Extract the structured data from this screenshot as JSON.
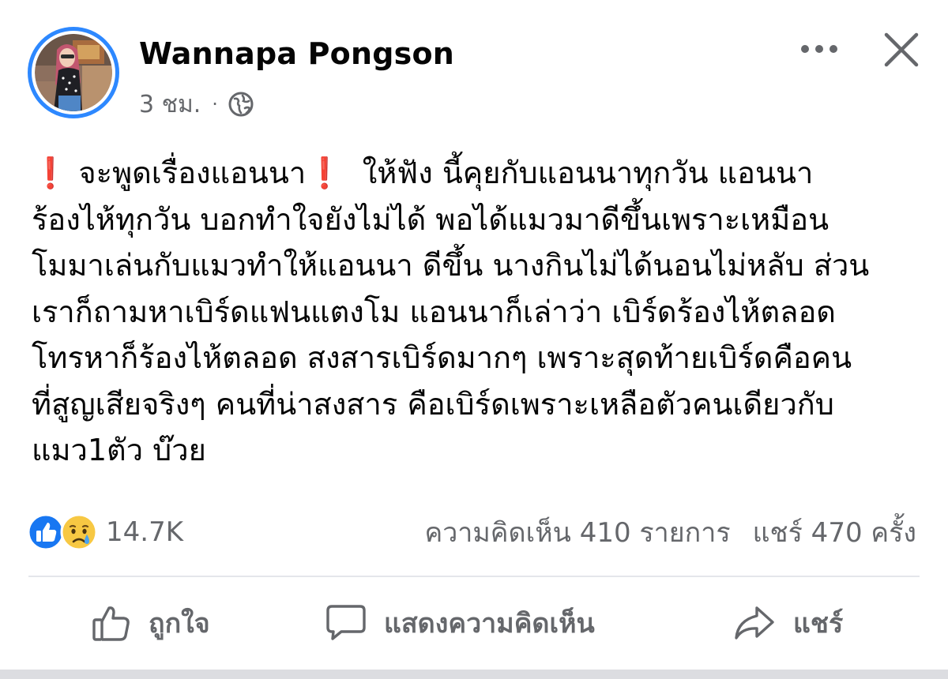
{
  "post": {
    "author": "Wannapa Pongson",
    "time": "3 ชม.",
    "separator": "·",
    "audience_icon": "globe-icon",
    "menu_icon": "more-horizontal-icon",
    "close_icon": "close-icon",
    "text_lines": [
      {
        "pre": "",
        "excl1": "❗",
        "mid": " จะพูดเรื่องแอนนา",
        "excl2": "❗",
        "post": "  ให้ฟัง นี้คุยกับแอนนาทุกวัน แอนนา"
      },
      "ร้องไห้ทุกวัน บอกทำใจยังไม่ได้ พอได้แมวมาดีขึ้นเพราะเหมือน",
      "โมมาเล่นกับแมวทำให้แอนนา ดีขึ้น นางกินไม่ได้นอนไม่หลับ ส่วน",
      "เราก็ถามหาเบิร์ดแฟนแตงโม แอนนาก็เล่าว่า เบิร์ดร้องไห้ตลอด",
      "โทรหาก็ร้องไห้ตลอด สงสารเบิร์ดมากๆ เพราะสุดท้ายเบิร์ดคือคน",
      "ที่สูญเสียจริงๆ คนที่น่าสงสาร คือเบิร์ดเพราะเหลือตัวคนเดียวกับ",
      "แมว1ตัว บ๊วย"
    ]
  },
  "reactions": {
    "icons": [
      "like-reaction-icon",
      "sad-reaction-icon"
    ],
    "count": "14.7K"
  },
  "stats": {
    "comments": "ความคิดเห็น 410 รายการ",
    "shares": "แชร์ 470 ครั้ง"
  },
  "actions": {
    "like": {
      "label": "ถูกใจ",
      "icon": "thumbs-up-icon"
    },
    "comment": {
      "label": "แสดงความคิดเห็น",
      "icon": "comment-icon"
    },
    "share": {
      "label": "แชร์",
      "icon": "share-arrow-icon"
    }
  },
  "colors": {
    "accent_blue": "#2d88ff",
    "secondary_text": "#65676b",
    "exclamation_red": "#e02424",
    "divider": "#e4e6eb"
  }
}
